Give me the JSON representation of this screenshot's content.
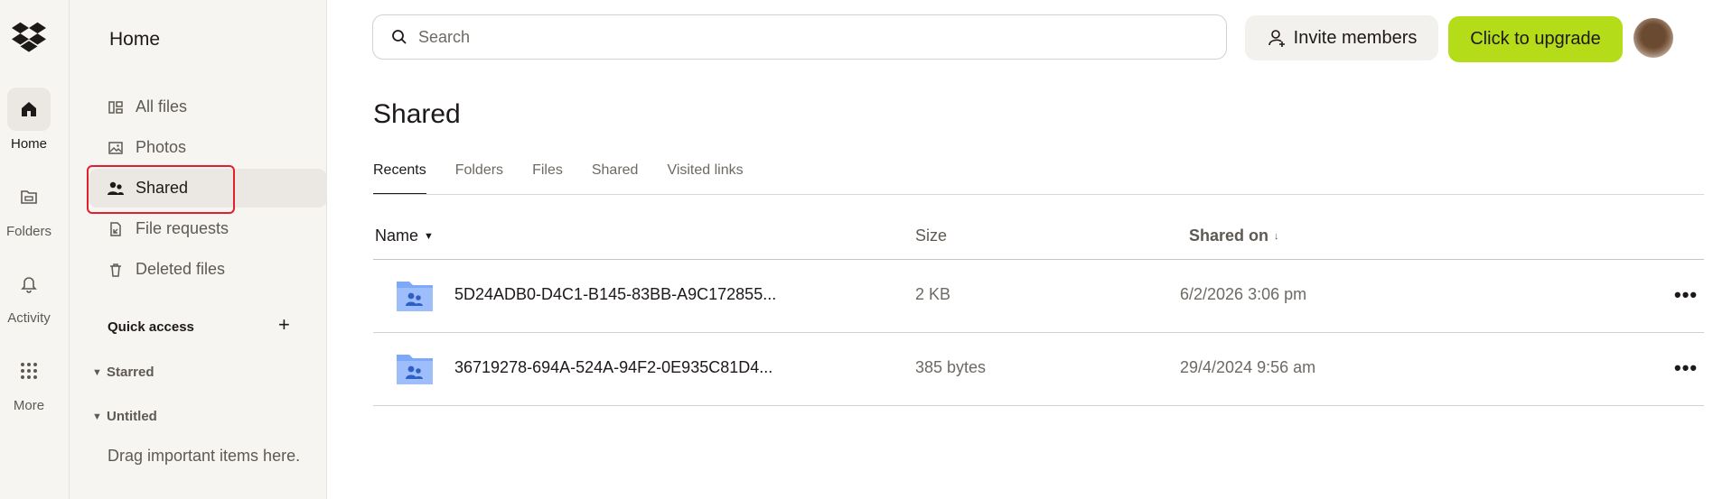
{
  "rail": {
    "items": [
      {
        "label": "Home",
        "icon": "home-icon",
        "active": true
      },
      {
        "label": "Folders",
        "icon": "folder-icon"
      },
      {
        "label": "Activity",
        "icon": "bell-icon"
      },
      {
        "label": "More",
        "icon": "grid-icon"
      }
    ]
  },
  "sidebar": {
    "title": "Home",
    "nav": [
      {
        "label": "All files",
        "icon": "all-files-icon"
      },
      {
        "label": "Photos",
        "icon": "photos-icon"
      },
      {
        "label": "Shared",
        "icon": "shared-icon",
        "active": true
      },
      {
        "label": "File requests",
        "icon": "file-request-icon"
      },
      {
        "label": "Deleted files",
        "icon": "trash-icon"
      }
    ],
    "quick_access": "Quick access",
    "plus": "+",
    "groups": [
      "Starred",
      "Untitled"
    ],
    "drag_hint": "Drag important items here."
  },
  "header": {
    "search_placeholder": "Search",
    "invite_label": "Invite members",
    "upgrade_label": "Click to upgrade"
  },
  "main": {
    "title": "Shared",
    "tabs": [
      "Recents",
      "Folders",
      "Files",
      "Shared",
      "Visited links"
    ],
    "columns": {
      "name": "Name",
      "size": "Size",
      "shared_on": "Shared on"
    },
    "rows": [
      {
        "name": "5D24ADB0-D4C1-B145-83BB-A9C172855...",
        "size": "2 KB",
        "shared_on": "6/2/2026 3:06 pm"
      },
      {
        "name": "36719278-694A-524A-94F2-0E935C81D4...",
        "size": "385 bytes",
        "shared_on": "29/4/2024 9:56 am"
      }
    ],
    "more_label": "•••"
  },
  "colors": {
    "accent_upgrade": "#b4dc19",
    "folder_blue": "#7ea8f8",
    "highlight_red": "#e2202b"
  }
}
